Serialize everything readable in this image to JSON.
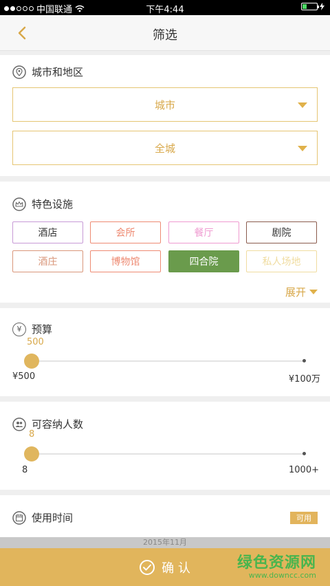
{
  "status": {
    "carrier": "中国联通",
    "time": "下午4:44"
  },
  "nav": {
    "title": "筛选"
  },
  "city": {
    "title": "城市和地区",
    "city_value": "城市",
    "district_value": "全城"
  },
  "facilities": {
    "title": "特色设施",
    "tags": [
      {
        "label": "酒店",
        "color": "#c79ad6"
      },
      {
        "label": "会所",
        "color": "#ee8a72"
      },
      {
        "label": "餐厅",
        "color": "#ef9ad0"
      },
      {
        "label": "剧院",
        "color": "#8a5a4c"
      },
      {
        "label": "酒庄",
        "color": "#d9967a"
      },
      {
        "label": "博物馆",
        "color": "#ee8a72"
      },
      {
        "label": "四合院",
        "color": "#6a9b4c",
        "selected": true
      },
      {
        "label": "私人场地",
        "color": "#f0dca0"
      }
    ],
    "expand_label": "展开"
  },
  "budget": {
    "title": "预算",
    "icon": "yen-icon",
    "current": "500",
    "min_label": "¥500",
    "max_label": "¥100万"
  },
  "capacity": {
    "title": "可容纳人数",
    "icon": "people-icon",
    "current": "8",
    "min_label": "8",
    "max_label": "1000+"
  },
  "time": {
    "title": "使用时间",
    "badge": "可用",
    "picker_peek": "2015年11月"
  },
  "confirm": {
    "label": "确 认"
  },
  "watermark": {
    "line1": "绿色资源网",
    "line2": "www.downcc.com"
  },
  "colors": {
    "accent": "#e1b55c",
    "text_gold": "#d8a84a"
  }
}
